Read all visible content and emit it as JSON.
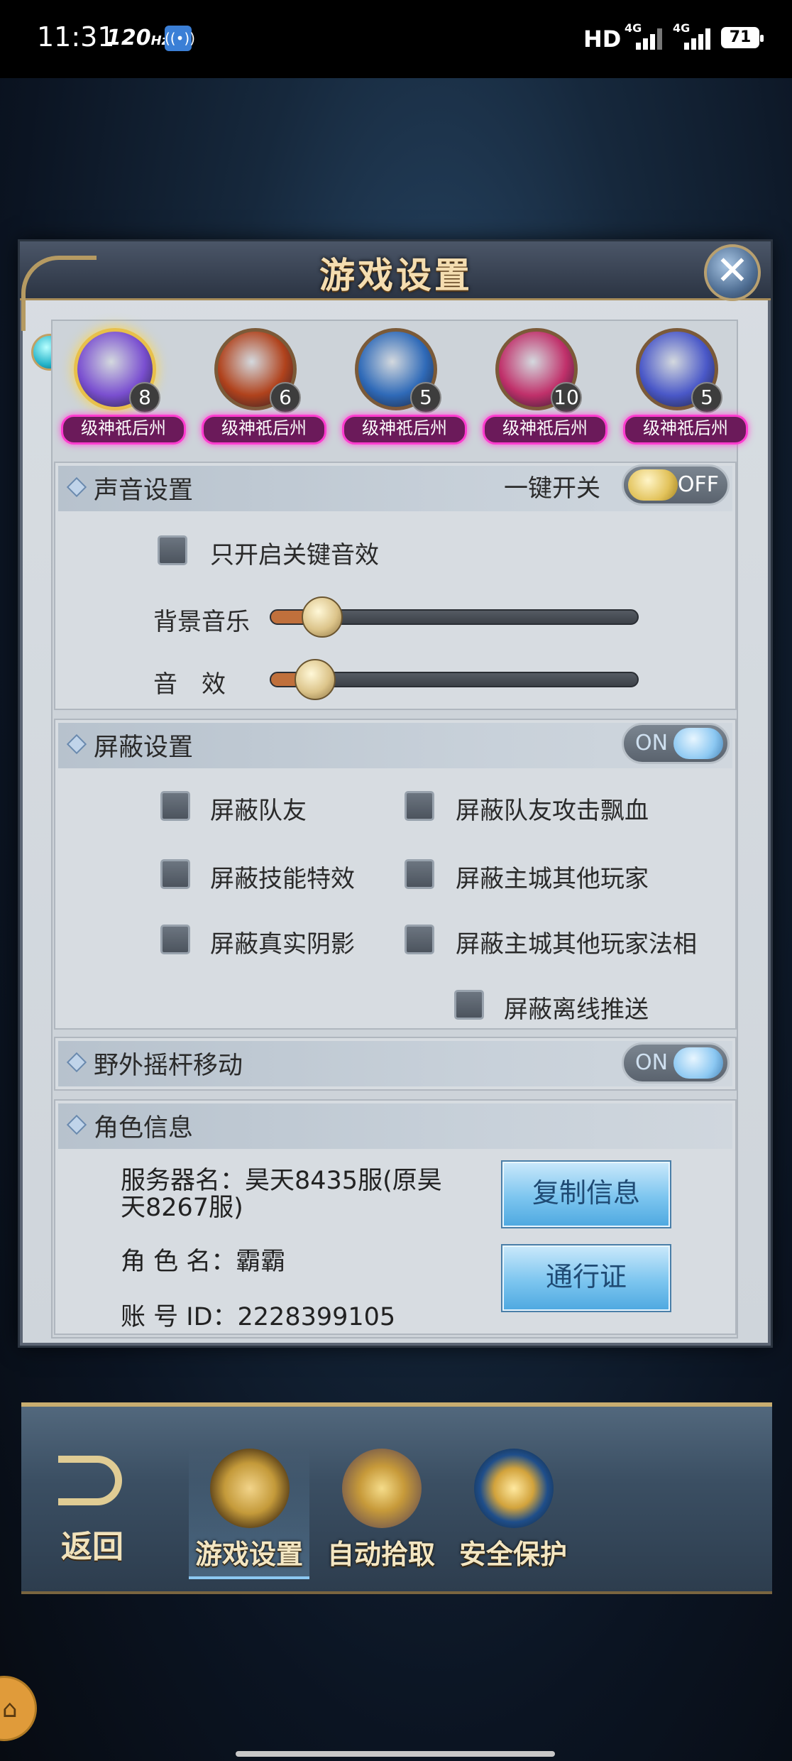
{
  "status_bar": {
    "time": "11:31",
    "refresh_rate": "120",
    "refresh_unit": "Hz",
    "hd": "HD",
    "net1": "4G",
    "net2": "4G",
    "battery": "71"
  },
  "dialog": {
    "title": "游戏设置",
    "close_label": "✕"
  },
  "heroes": [
    {
      "level": "8",
      "tag": "级神祇后州",
      "color": "#7a4fd0"
    },
    {
      "level": "6",
      "tag": "级神祇后州",
      "color": "#b0421c"
    },
    {
      "level": "5",
      "tag": "级神祇后州",
      "color": "#2f6ab8"
    },
    {
      "level": "10",
      "tag": "级神祇后州",
      "color": "#c0306a"
    },
    {
      "level": "5",
      "tag": "级神祇后州",
      "color": "#4a58c8"
    }
  ],
  "sound": {
    "title": "声音设置",
    "master_label": "一键开关",
    "master_state": "OFF",
    "key_sfx_label": "只开启关键音效",
    "bgm_label": "背景音乐",
    "bgm_level": 0.1,
    "sfx_label": "音　效",
    "sfx_level": 0.08
  },
  "block": {
    "title": "屏蔽设置",
    "state": "ON",
    "options": {
      "teammates": "屏蔽队友",
      "teammate_dmg": "屏蔽队友攻击飘血",
      "skill_fx": "屏蔽技能特效",
      "city_players": "屏蔽主城其他玩家",
      "shadows": "屏蔽真实阴影",
      "city_dharma": "屏蔽主城其他玩家法相",
      "offline_push": "屏蔽离线推送"
    }
  },
  "joystick": {
    "title": "野外摇杆移动",
    "state": "ON"
  },
  "role": {
    "title": "角色信息",
    "server_line1": "服务器名：昊天8435服(原昊",
    "server_line2": "天8267服)",
    "name_line": "角 色 名：霸霸",
    "account_line": "账 号 ID：2228399105",
    "copy_button": "复制信息",
    "pass_button": "通行证"
  },
  "bottom": {
    "back_label": "返回",
    "tabs": [
      "游戏设置",
      "自动拾取",
      "安全保护"
    ]
  }
}
